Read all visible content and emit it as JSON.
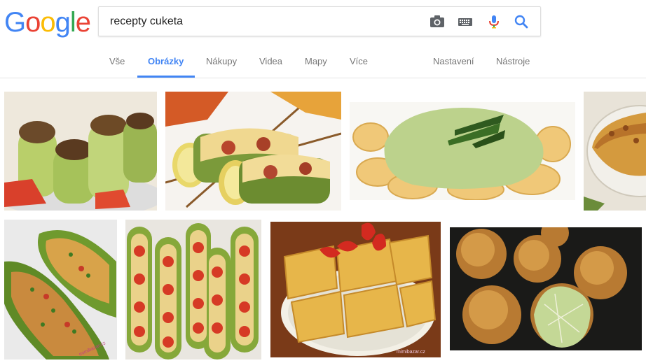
{
  "search": {
    "query": "recepty cuketa"
  },
  "tabs": {
    "all": "Vše",
    "images": "Obrázky",
    "shopping": "Nákupy",
    "videos": "Videa",
    "maps": "Mapy",
    "more": "Více",
    "settings": "Nastavení",
    "tools": "Nástroje"
  },
  "logo": {
    "letters": [
      "G",
      "o",
      "o",
      "g",
      "l",
      "e"
    ],
    "colors": [
      "#4285F4",
      "#EA4335",
      "#FBBC05",
      "#4285F4",
      "#34A853",
      "#EA4335"
    ]
  },
  "icons": [
    "camera-icon",
    "keyboard-icon",
    "microphone-icon",
    "search-icon"
  ],
  "results": [
    {
      "name": "stuffed-zucchini-rolls",
      "watermark": ""
    },
    {
      "name": "zucchini-skewers",
      "watermark": ""
    },
    {
      "name": "pasta-zucchini-sauce",
      "watermark": ""
    },
    {
      "name": "zucchini-tart",
      "watermark": ""
    },
    {
      "name": "stuffed-zucchini-boats",
      "watermark": "mimibazar.cz"
    },
    {
      "name": "zucchini-pizza-boats",
      "watermark": ""
    },
    {
      "name": "zucchini-bake-squares",
      "watermark": "mimibazar.cz"
    },
    {
      "name": "zucchini-balls",
      "watermark": ""
    }
  ],
  "colors": {
    "accent": "#4285f4",
    "tab_text": "#777777"
  }
}
